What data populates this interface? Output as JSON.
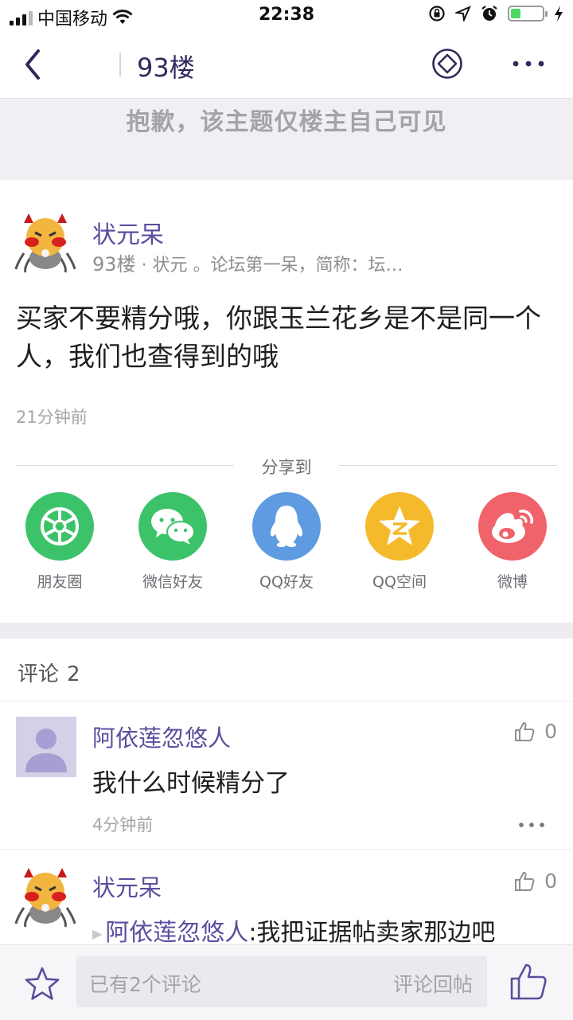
{
  "status_bar": {
    "carrier": "中国移动",
    "time": "22:38"
  },
  "nav": {
    "title": "93楼"
  },
  "notice": {
    "text": "抱歉，该主题仅楼主自己可见"
  },
  "post": {
    "author": "状元呆",
    "floor": "93楼",
    "meta": "· 状元 。论坛第一呆，简称：坛…",
    "body": "买家不要精分哦，你跟玉兰花乡是不是同一个人，我们也查得到的哦",
    "time": "21分钟前"
  },
  "share": {
    "label": "分享到",
    "items": [
      {
        "label": "朋友圈",
        "icon": "moments-aperture-icon",
        "color": "#3cc36a"
      },
      {
        "label": "微信好友",
        "icon": "wechat-icon",
        "color": "#3cc36a"
      },
      {
        "label": "QQ好友",
        "icon": "qq-penguin-icon",
        "color": "#5f9be0"
      },
      {
        "label": "QQ空间",
        "icon": "qzone-star-icon",
        "color": "#f5b92c"
      },
      {
        "label": "微博",
        "icon": "weibo-icon",
        "color": "#f0636a"
      }
    ]
  },
  "comments": {
    "label": "评论",
    "count": "2",
    "items": [
      {
        "author": "阿依莲忽悠人",
        "text": "我什么时候精分了",
        "time": "4分钟前",
        "likes": "0"
      },
      {
        "author": "状元呆",
        "mention": "阿依莲忽悠人",
        "reply_text": ":我把证据帖卖家那边吧",
        "likes": "0"
      }
    ]
  },
  "bottom_bar": {
    "input_placeholder": "已有2个评论",
    "reply_action": "评论回帖"
  },
  "colors": {
    "accent": "#5b4e9e",
    "title": "#2f2a5c",
    "notice_bg": "#f0eff4"
  }
}
